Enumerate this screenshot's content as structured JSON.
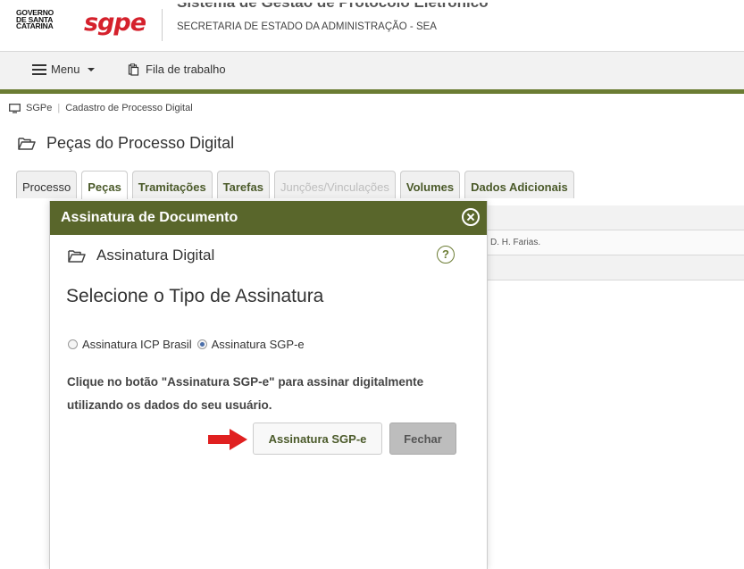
{
  "header": {
    "gov_logo_lines": [
      "GOVERNO",
      "DE SANTA",
      "CATARINA"
    ],
    "brand": "sgpe",
    "system_title": "Sistema de Gestão de Protocolo Eletrônico",
    "subtitle": "SECRETARIA DE ESTADO DA ADMINISTRAÇÃO - SEA"
  },
  "nav": {
    "menu_label": "Menu",
    "queue_label": "Fila de trabalho"
  },
  "breadcrumb": {
    "root": "SGPe",
    "current": "Cadastro de Processo Digital"
  },
  "page": {
    "title": "Peças do Processo Digital"
  },
  "tabs": [
    {
      "label": "Processo"
    },
    {
      "label": "Peças"
    },
    {
      "label": "Tramitações"
    },
    {
      "label": "Tarefas"
    },
    {
      "label": "Junções/Vinculações"
    },
    {
      "label": "Volumes"
    },
    {
      "label": "Dados Adicionais"
    }
  ],
  "background_table": {
    "row_text": "D. H. Farias."
  },
  "modal": {
    "title": "Assinatura de Documento",
    "subtitle": "Assinatura Digital",
    "help": "?",
    "select_title": "Selecione o Tipo de Assinatura",
    "options": [
      {
        "label": "Assinatura ICP Brasil",
        "checked": false
      },
      {
        "label": "Assinatura SGP-e",
        "checked": true
      }
    ],
    "instruction": "Clique no botão \"Assinatura SGP-e\" para assinar digitalmente utilizando os dados do seu usuário.",
    "sign_button": "Assinatura SGP-e",
    "close_button": "Fechar"
  },
  "colors": {
    "brand_red": "#d5212c",
    "header_green": "#59662b",
    "nav_border": "#6b7c33",
    "arrow_red": "#e02020"
  },
  "icons": {
    "menu": "hamburger-icon",
    "queue": "clipboard-icon",
    "breadcrumb": "monitor-icon",
    "page_title": "folder-open-icon",
    "modal_close": "close-circle-icon",
    "help": "question-circle-icon",
    "pointer": "red-arrow-icon"
  }
}
